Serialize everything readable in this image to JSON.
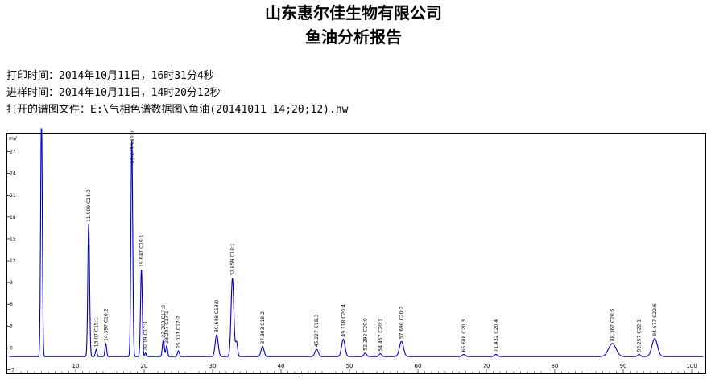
{
  "report": {
    "company": "山东惠尔佳生物有限公司",
    "title": "鱼油分析报告",
    "print_time": "打印时间：2014年10月11日，16时31分4秒",
    "sample_time": "进样时间：2014年10月11日，14时20分12秒",
    "file": "打开的谱图文件：E:\\气相色谱数据图\\鱼油(20141011 14;20;12).hw"
  },
  "chart_data": {
    "type": "line",
    "title": "",
    "xlabel": "",
    "ylabel": "mV",
    "xlim": [
      0,
      102
    ],
    "ylim": [
      -3.5,
      29.5
    ],
    "x_ticks": [
      10,
      20,
      30,
      40,
      50,
      60,
      70,
      80,
      90,
      100
    ],
    "y_ticks": [
      -3,
      0,
      3,
      6,
      9,
      12,
      15,
      18,
      21,
      24,
      27
    ],
    "y_tick_labels": [
      "-3",
      "0",
      "3",
      "6",
      "9",
      "12",
      "15",
      "18",
      "21",
      "24",
      "27"
    ],
    "baseline": -1.2,
    "line_color": "#0000cc",
    "peaks": [
      {
        "t": 5.0,
        "h": 34.0,
        "w": 0.12,
        "label": ""
      },
      {
        "t": 11.9,
        "h": 18.2,
        "w": 0.13,
        "label": "11.909 C14:0"
      },
      {
        "t": 13.0,
        "h": 1.0,
        "w": 0.12,
        "label": "13.07 C15:1"
      },
      {
        "t": 14.4,
        "h": 1.8,
        "w": 0.12,
        "label": "14.397 C16:2"
      },
      {
        "t": 18.2,
        "h": 30.0,
        "w": 0.13,
        "label": "18.274 C16:0"
      },
      {
        "t": 19.6,
        "h": 12.0,
        "w": 0.13,
        "label": "19.647 C16:1"
      },
      {
        "t": 20.2,
        "h": 0.5,
        "w": 0.1,
        "label": "20.19 C17:1"
      },
      {
        "t": 22.8,
        "h": 2.3,
        "w": 0.14,
        "label": "22.763 C17:0"
      },
      {
        "t": 23.3,
        "h": 1.5,
        "w": 0.12,
        "label": "23.247 C17:1"
      },
      {
        "t": 25.0,
        "h": 0.8,
        "w": 0.14,
        "label": "25.037 C17:2"
      },
      {
        "t": 30.6,
        "h": 3.0,
        "w": 0.22,
        "label": "30.648 C18:0"
      },
      {
        "t": 32.9,
        "h": 10.8,
        "w": 0.2,
        "label": "32.859 C18:1"
      },
      {
        "t": 33.5,
        "h": 2.0,
        "w": 0.15,
        "label": ""
      },
      {
        "t": 37.3,
        "h": 1.4,
        "w": 0.22,
        "label": "37.303 C18:2"
      },
      {
        "t": 45.2,
        "h": 1.0,
        "w": 0.25,
        "label": "45.227 C18:3"
      },
      {
        "t": 49.1,
        "h": 2.4,
        "w": 0.25,
        "label": "49.118 C20:4"
      },
      {
        "t": 52.3,
        "h": 0.5,
        "w": 0.2,
        "label": "52.292 C20:0"
      },
      {
        "t": 54.5,
        "h": 0.4,
        "w": 0.2,
        "label": "54.467 C20:1"
      },
      {
        "t": 57.6,
        "h": 2.1,
        "w": 0.3,
        "label": "57.690 C20:2"
      },
      {
        "t": 66.7,
        "h": 0.3,
        "w": 0.25,
        "label": "66.688 C20:3"
      },
      {
        "t": 71.4,
        "h": 0.3,
        "w": 0.25,
        "label": "71.432 C20:4"
      },
      {
        "t": 88.4,
        "h": 1.8,
        "w": 0.55,
        "label": "88.367 C20:5"
      },
      {
        "t": 92.3,
        "h": 0.3,
        "w": 0.2,
        "label": "92.257 C22:1"
      },
      {
        "t": 94.6,
        "h": 2.5,
        "w": 0.4,
        "label": "94.577 C22:6"
      }
    ]
  }
}
